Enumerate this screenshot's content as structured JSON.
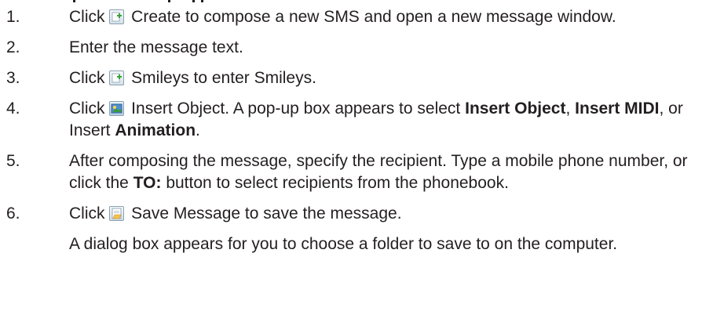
{
  "steps": [
    {
      "number": "1.",
      "icon": "create-icon",
      "before": "Click ",
      "after": " Create to compose a new SMS and open a new message window."
    },
    {
      "number": "2.",
      "text": "Enter the message text."
    },
    {
      "number": "3.",
      "icon": "smileys-icon",
      "before": "Click ",
      "after": " Smileys to enter Smileys."
    },
    {
      "number": "4.",
      "icon": "insert-object-icon",
      "before": "Click ",
      "after": " Insert Object. A pop-up box appears to select ",
      "bold1": "Insert Object",
      "mid1": ", ",
      "bold2": "Insert MIDI",
      "mid2": ", or Insert ",
      "bold3": "Animation",
      "end": "."
    },
    {
      "number": "5.",
      "before": "After composing the message, specify the recipient. Type a mobile phone number, or click the ",
      "bold": "TO:",
      "after": " button to select recipients from the phonebook."
    },
    {
      "number": "6.",
      "icon": "save-message-icon",
      "before": "Click ",
      "after": " Save Message to save the message.",
      "note": "A dialog box appears for you to choose a folder to save to on the computer."
    }
  ]
}
